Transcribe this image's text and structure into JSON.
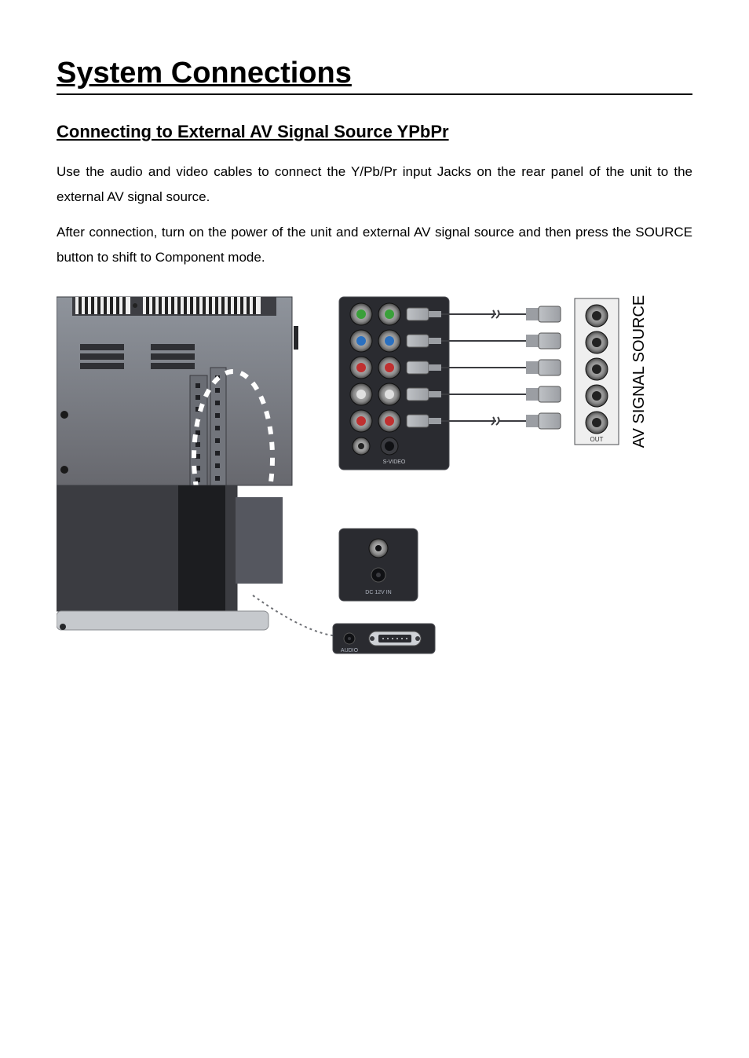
{
  "heading": "System Connections",
  "sub_heading": "Connecting to External AV Signal Source  YPbPr",
  "paragraph1": "Use the audio and video cables to connect the Y/Pb/Pr input Jacks on the rear panel of the unit to the external AV signal source.",
  "paragraph2": "After connection, turn on the power of the unit and external AV signal source and then press the SOURCE button to shift to Component mode.",
  "diagram": {
    "vertical_label": "AV SIGNAL SOURCE",
    "bottom_label_left": "AUDIO",
    "bottom_label_dc": "DC 12V IN",
    "tv_panel_label": "S-VIDEO",
    "source_out_label": "OUT",
    "connectors": {
      "tv_rows": [
        {
          "colorL": "#3aa03a",
          "colorR": "#3aa03a"
        },
        {
          "colorL": "#2a70c0",
          "colorR": "#2a70c0"
        },
        {
          "colorL": "#c03030",
          "colorR": "#c03030"
        },
        {
          "colorL": "#e0e0e0",
          "colorR": "#e0e0e0"
        },
        {
          "colorL": "#c03030",
          "colorR": "#c03030"
        }
      ],
      "source_ports": [
        {
          "color": "#3aa03a"
        },
        {
          "color": "#2a70c0"
        },
        {
          "color": "#c03030"
        },
        {
          "color": "#e0e0e0"
        },
        {
          "color": "#c03030"
        }
      ]
    }
  }
}
